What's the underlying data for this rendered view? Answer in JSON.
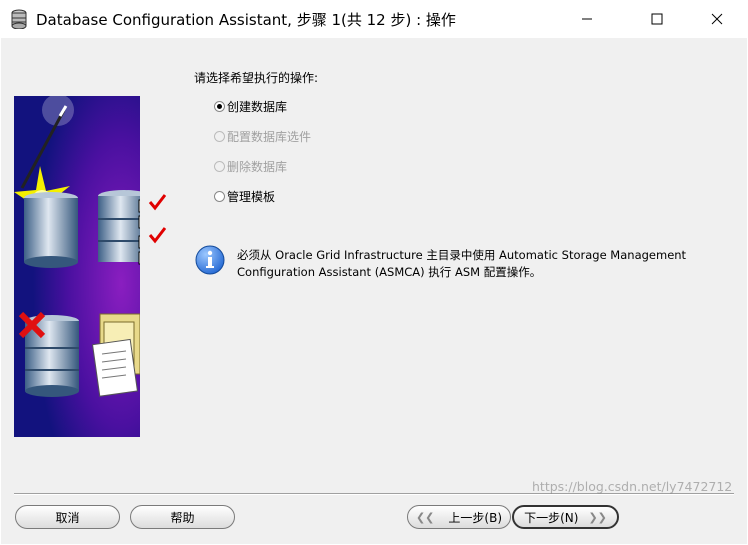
{
  "window": {
    "title": "Database Configuration Assistant, 步骤 1(共 12 步) : 操作",
    "controls": [
      "minimize-icon",
      "maximize-icon",
      "close-icon"
    ]
  },
  "main": {
    "prompt": "请选择希望执行的操作:",
    "options": [
      {
        "label": "创建数据库",
        "selected": true,
        "enabled": true
      },
      {
        "label": "配置数据库选件",
        "selected": false,
        "enabled": false
      },
      {
        "label": "删除数据库",
        "selected": false,
        "enabled": false
      },
      {
        "label": "管理模板",
        "selected": false,
        "enabled": true
      }
    ],
    "info": {
      "icon": "info-icon",
      "line1": "必须从 Oracle Grid Infrastructure 主目录中使用 Automatic Storage Management",
      "line2": "Configuration Assistant (ASMCA) 执行 ASM 配置操作。"
    }
  },
  "buttons": {
    "cancel": "取消",
    "help": "帮助",
    "back": "上一步(B)",
    "next": "下一步(N)"
  },
  "watermark": "https://blog.csdn.net/ly7472712",
  "colors": {
    "image_gradient_top": "#1a1a8c",
    "image_gradient_mid": "#6a0aa8",
    "checkmark": "#e00000",
    "x_mark": "#e01010"
  }
}
